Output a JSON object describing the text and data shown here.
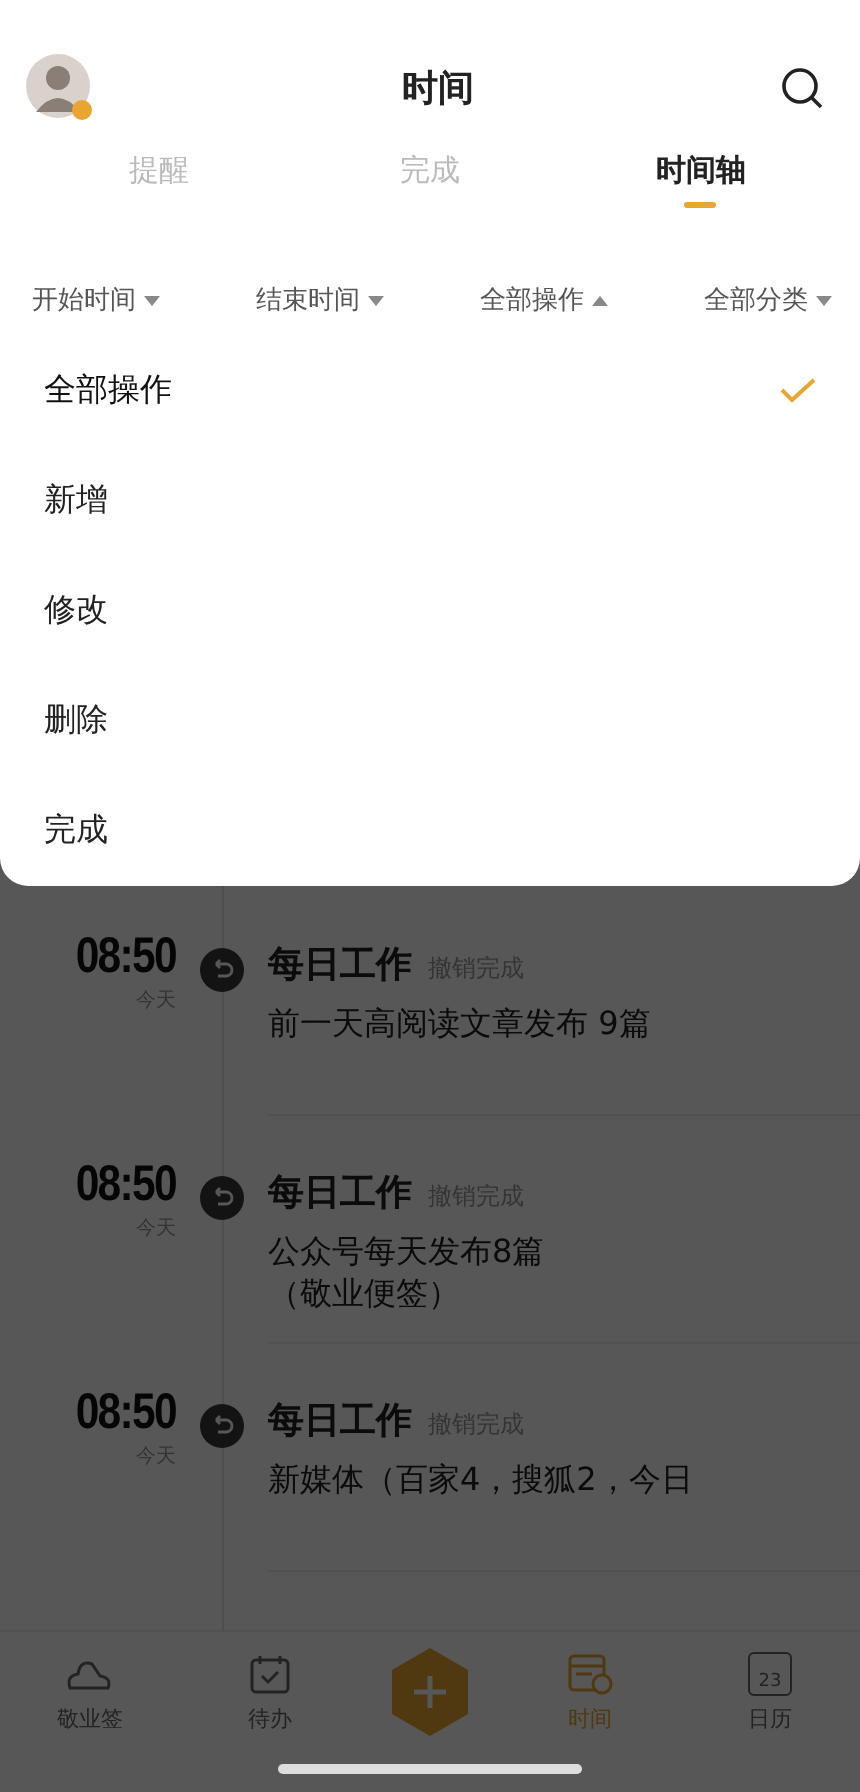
{
  "header": {
    "title": "时间"
  },
  "tabs": [
    {
      "label": "提醒",
      "selected": false
    },
    {
      "label": "完成",
      "selected": false
    },
    {
      "label": "时间轴",
      "selected": true
    }
  ],
  "filters": [
    {
      "label": "开始时间",
      "open": false
    },
    {
      "label": "结束时间",
      "open": false
    },
    {
      "label": "全部操作",
      "open": true
    },
    {
      "label": "全部分类",
      "open": false
    }
  ],
  "menu": [
    {
      "label": "全部操作",
      "selected": true
    },
    {
      "label": "新增",
      "selected": false
    },
    {
      "label": "修改",
      "selected": false
    },
    {
      "label": "删除",
      "selected": false
    },
    {
      "label": "完成",
      "selected": false
    }
  ],
  "timeline": [
    {
      "time": "08:50",
      "day": "今天",
      "category": "每日工作",
      "action": "撤销完成",
      "lines": [
        "前一天高阅读文章发布 9篇"
      ]
    },
    {
      "time": "08:50",
      "day": "今天",
      "category": "每日工作",
      "action": "撤销完成",
      "lines": [
        "公众号每天发布8篇",
        "（敬业便签）"
      ]
    },
    {
      "time": "08:50",
      "day": "今天",
      "category": "每日工作",
      "action": "撤销完成",
      "lines": [
        "新媒体（百家4，搜狐2，今日"
      ]
    }
  ],
  "nav": [
    {
      "kind": "tab",
      "label": "敬业签",
      "selected": false
    },
    {
      "kind": "tab",
      "label": "待办",
      "selected": false
    },
    {
      "kind": "add"
    },
    {
      "kind": "tab",
      "label": "时间",
      "selected": true
    },
    {
      "kind": "tab",
      "label": "日历",
      "date": "23",
      "selected": false
    }
  ]
}
